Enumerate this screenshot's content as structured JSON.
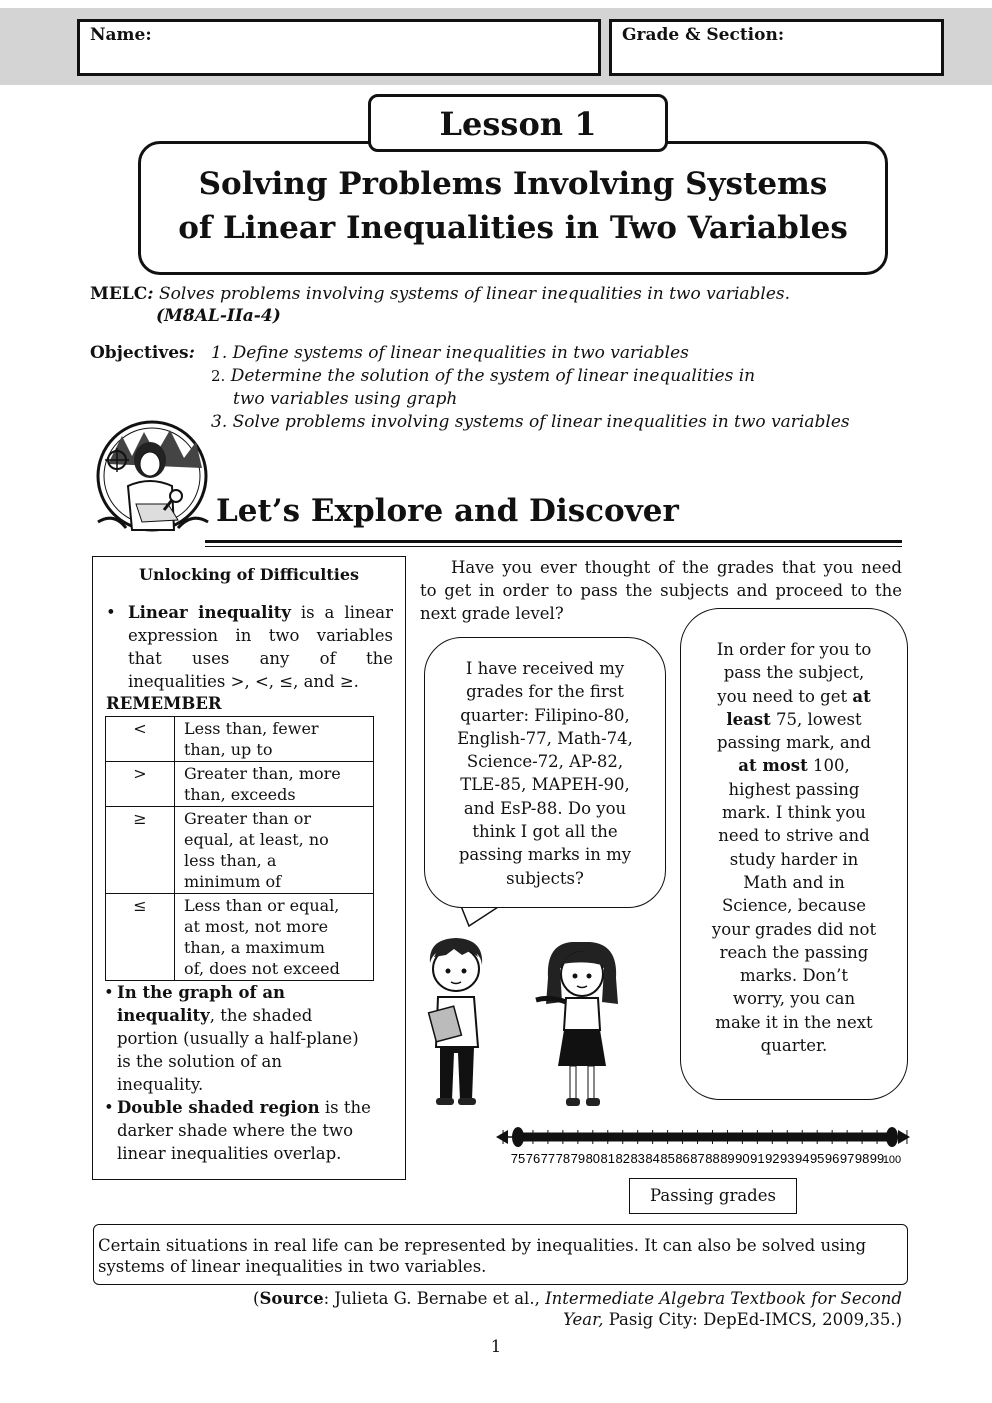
{
  "header": {
    "name_label": "Name:",
    "grade_label": "Grade & Section:"
  },
  "lesson": {
    "tab": "Lesson 1",
    "title_line1": "Solving Problems Involving Systems",
    "title_line2": "of Linear Inequalities in Two Variables"
  },
  "melc": {
    "label": "MELC",
    "colon": ":",
    "text": " Solves problems involving systems of linear inequalities in two variables.",
    "code": "(M8AL-IIa-4)"
  },
  "objectives": {
    "label": "Objectives",
    "colon": ":",
    "items": [
      {
        "num": "1.",
        "text": "Define systems of linear inequalities in two variables"
      },
      {
        "num": "2.",
        "text": "Determine the solution of the system of linear inequalities in",
        "text2": "two variables using graph"
      },
      {
        "num": "3.",
        "text": "Solve problems involving systems of linear inequalities in two variables"
      }
    ]
  },
  "section_title": "Let’s Explore and Discover",
  "unlocking": {
    "title": "Unlocking of Difficulties",
    "b1_term": "Linear inequality",
    "b1_lines": [
      " is a linear",
      "expression in two variables",
      "that uses any of the",
      "inequalities >, <, ≤, and ≥."
    ],
    "remember": "REMEMBER",
    "table": [
      {
        "sym": "<",
        "lines": [
          "Less than, fewer",
          "than, up to"
        ]
      },
      {
        "sym": ">",
        "lines": [
          "Greater than, more",
          "than, exceeds"
        ]
      },
      {
        "sym": "≥",
        "lines": [
          "Greater than or",
          "equal, at least, no",
          "less than, a",
          "minimum of"
        ]
      },
      {
        "sym": "≤",
        "lines": [
          "Less than or equal,",
          "at most, not more",
          "than, a maximum",
          "of, does not exceed"
        ]
      }
    ],
    "b2_term1": "In the graph of an",
    "b2_term2": "inequality",
    "b2_lines": [
      ", the shaded",
      "portion (usually a half-plane)",
      "is the solution of an",
      "inequality."
    ],
    "b3_term": "Double shaded region",
    "b3_lines": [
      " is the",
      "darker shade where the two",
      "linear inequalities overlap."
    ]
  },
  "intro": [
    "Have you ever thought of the grades that you need",
    "to get in order to pass the subjects and proceed to the",
    "next grade level?"
  ],
  "boy_bubble": [
    "I have received my",
    "grades for the first",
    "quarter: Filipino-80,",
    "English-77, Math-74,",
    "Science-72, AP-82,",
    "TLE-85, MAPEH-90,",
    "and EsP-88. Do you",
    "think I got all the",
    "passing marks in my",
    "subjects?"
  ],
  "girl_bubble": {
    "l1": "In order for you to",
    "l2": "pass the subject,",
    "l3a": "you need to get ",
    "l3b": "at",
    "l4a": "least",
    "l4b": " 75, lowest",
    "l5": "passing mark, and",
    "l6a": "at most",
    "l6b": " 100,",
    "rest": [
      "highest passing",
      "mark. I think you",
      "need to strive and",
      "study harder in",
      "Math and in",
      "Science, because",
      "your grades did not",
      "reach the passing",
      "marks. Don’t",
      "worry, you can",
      "make it in the next",
      "quarter."
    ]
  },
  "number_line": {
    "start": 75,
    "end": 100,
    "labels": [
      "75",
      "76",
      "77",
      "78",
      "79",
      "80",
      "81",
      "82",
      "83",
      "84",
      "85",
      "86",
      "87",
      "88",
      "89",
      "90",
      "91",
      "92",
      "93",
      "94",
      "95",
      "96",
      "97",
      "98",
      "99",
      "100"
    ]
  },
  "passing_label": "Passing grades",
  "footer_note": [
    "Certain situations in real life can be represented by inequalities. It can also be solved using",
    "systems of linear inequalities in two variables."
  ],
  "source": {
    "open": "(",
    "label": "Source",
    "authors": ": Julieta G. Bernabe et al., ",
    "book1": "Intermediate Algebra Textbook for Second",
    "book2": "Year,",
    "pub": " Pasig City: DepEd-IMCS, 2009,35.)"
  },
  "page_number": "1"
}
